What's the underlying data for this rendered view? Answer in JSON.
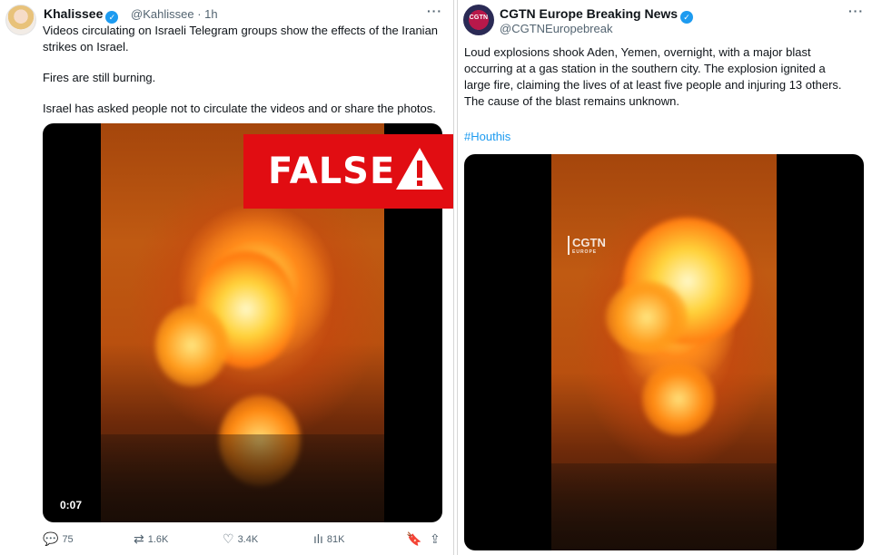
{
  "left_tweet": {
    "author_name": "Khalissee",
    "author_handle": "@Kahlissee",
    "time": "1h",
    "separator": "·",
    "more_label": "···",
    "text_line1": "Videos circulating on Israeli Telegram groups show the effects of the Iranian",
    "text_line2": "strikes on Israel.",
    "text_line3": "Fires are still burning.",
    "text_line4": "Israel has asked people not to circulate the videos and or share the photos.",
    "video_duration": "0:07",
    "overlay_label": "FALSE",
    "actions": {
      "replies": "75",
      "reposts": "1.6K",
      "likes": "3.4K",
      "views": "81K"
    },
    "icons": [
      "reply-icon",
      "repost-icon",
      "like-icon",
      "views-icon",
      "bookmark-icon",
      "share-icon"
    ]
  },
  "right_tweet": {
    "author_name": "CGTN Europe Breaking News",
    "author_handle": "@CGTNEuropebreak",
    "avatar_text": "CGTN",
    "more_label": "···",
    "text_line1": "Loud explosions shook Aden, Yemen, overnight, with a major blast",
    "text_line2": "occurring at a gas station in the southern city. The explosion ignited a",
    "text_line3": "large fire, claiming the lives of at least five people and injuring 13 others.",
    "text_line4": "The cause of the blast remains unknown.",
    "hashtag": "#Houthis",
    "watermark": "CGTN",
    "watermark_sub": "EUROPE"
  },
  "colors": {
    "verified": "#1d9bf0",
    "false_red": "#e10d12",
    "hashtag": "#1d9bf0"
  }
}
